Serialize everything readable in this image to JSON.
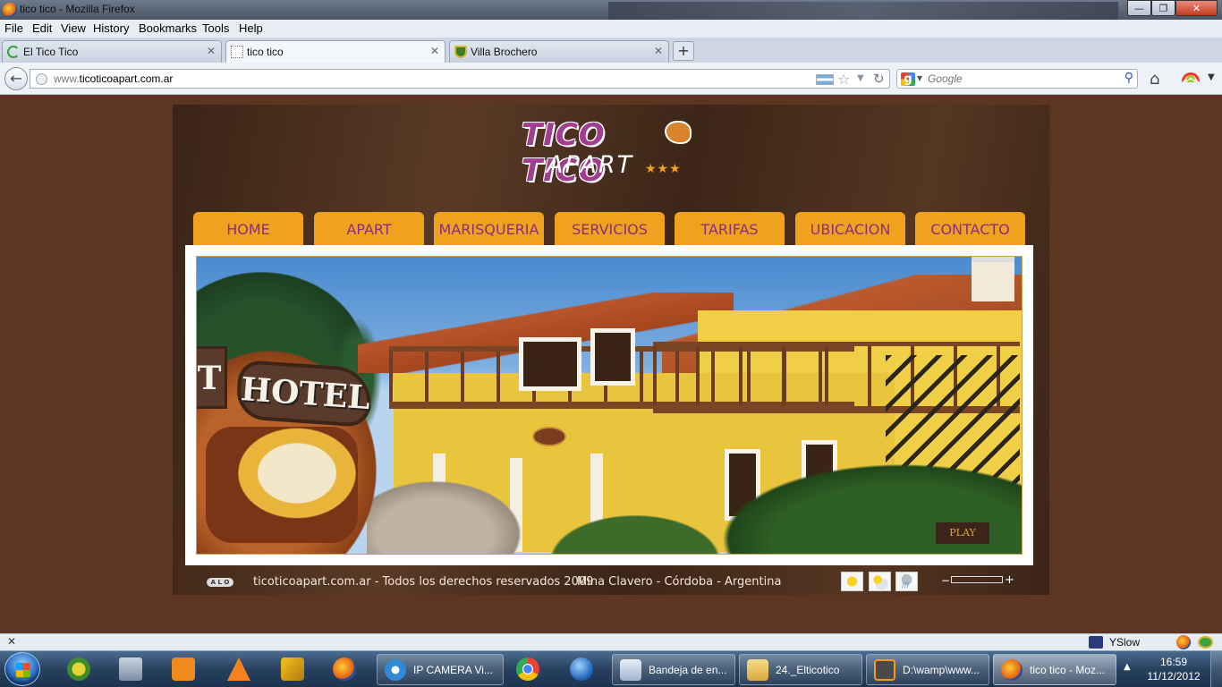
{
  "window": {
    "title": "tico tico - Mozilla Firefox",
    "min": "—",
    "max": "❐",
    "close": "✕"
  },
  "menu": [
    "File",
    "Edit",
    "View",
    "History",
    "Bookmarks",
    "Tools",
    "Help"
  ],
  "tabs": [
    {
      "label": "El Tico Tico",
      "close": "✕"
    },
    {
      "label": "tico tico",
      "close": "✕"
    },
    {
      "label": "Villa Brochero",
      "close": "✕"
    }
  ],
  "new_tab": "+",
  "navbar": {
    "back": "←",
    "url_prefix": "www.",
    "url_domain": "ticoticoapart.com.ar",
    "star": "☆",
    "dropdown": "▼",
    "reload": "↻",
    "search_engine": "g",
    "search_placeholder": "Google",
    "search_icon": "⚲",
    "home": "⌂",
    "menu_dropdown": "▼"
  },
  "site": {
    "logo_main": "TICO TICO",
    "logo_sub": "APART",
    "logo_stars": "★★★",
    "nav": [
      "HOME",
      "APART",
      "MARISQUERIA",
      "SERVICIOS",
      "TARIFAS",
      "UBICACION",
      "CONTACTO"
    ],
    "photo": {
      "sign_text": "HOTEL",
      "sign_letter": "T",
      "play_label": "PLAY"
    },
    "footer": {
      "badge": "A L O",
      "copyright": "ticoticoapart.com.ar - Todos los derechos reservados 2009",
      "location": "Mina Clavero - Córdoba - Argentina",
      "vol_minus": "−",
      "vol_plus": "+"
    }
  },
  "addon_bar": {
    "close": "✕",
    "yslow": "YSlow"
  },
  "taskbar": {
    "tasks": [
      "IP CAMERA Vi...",
      "Bandeja de en...",
      "24._Elticotico",
      "D:\\wamp\\www...",
      "tico tico - Moz..."
    ],
    "tray_arrow": "▲",
    "time": "16:59",
    "date": "11/12/2012"
  },
  "colors": {
    "page_bg": "#5c3622",
    "nav_tab": "#f0a21e",
    "nav_text": "#8a2e7e",
    "logo": "#a13e8f"
  }
}
